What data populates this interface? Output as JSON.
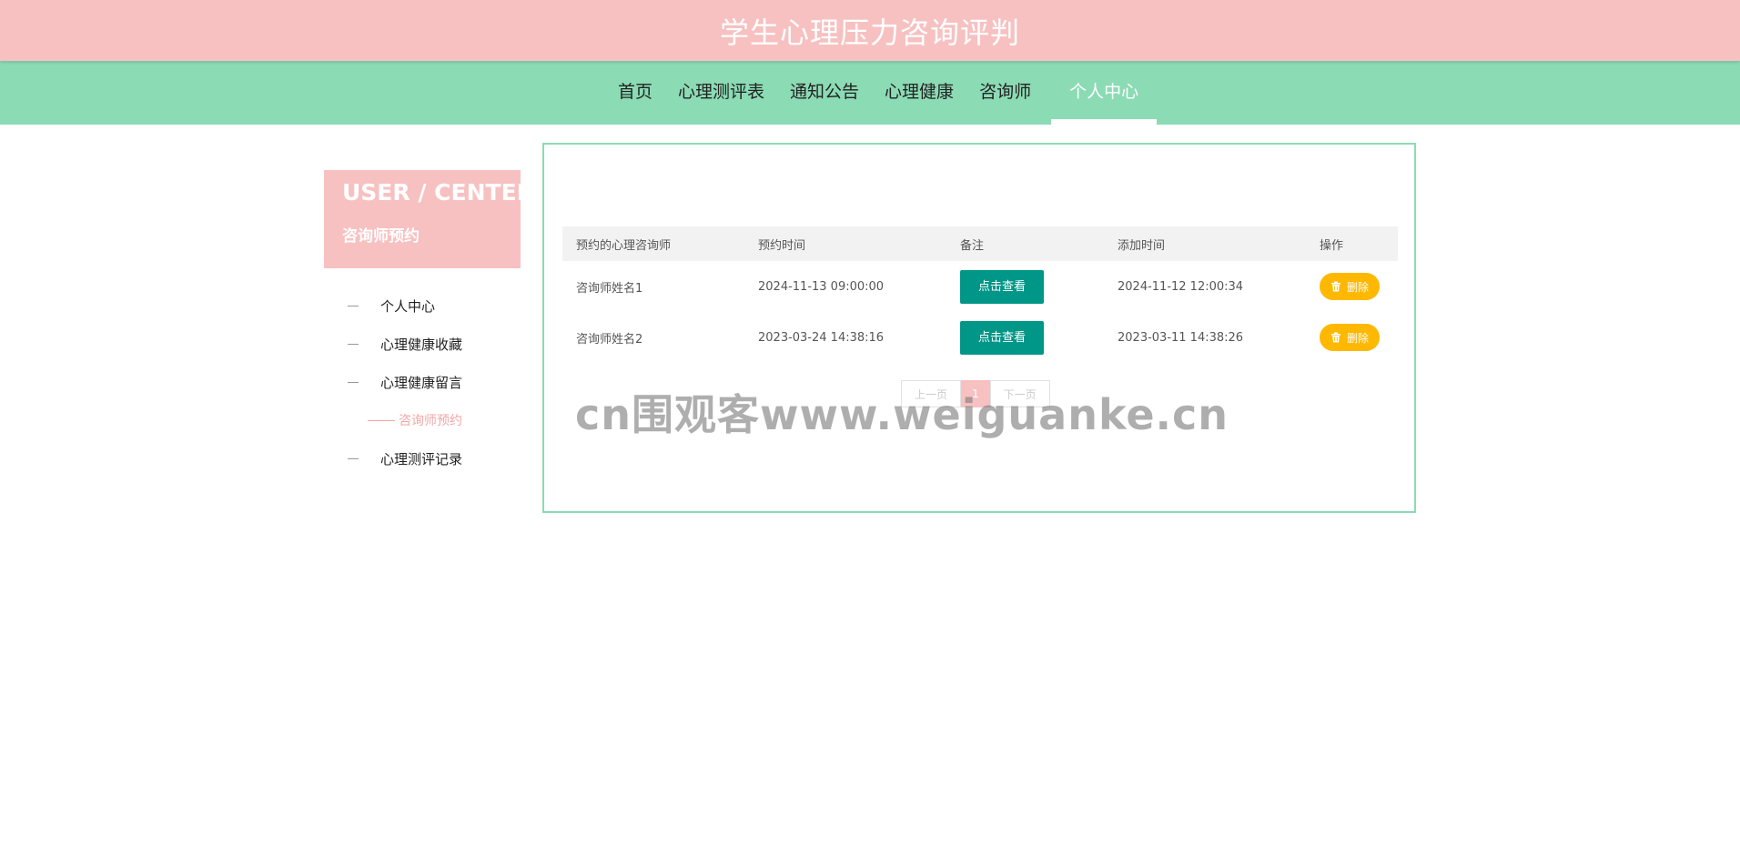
{
  "header": {
    "title": "学生心理压力咨询评判"
  },
  "nav": {
    "items": [
      {
        "label": "首页"
      },
      {
        "label": "心理测评表"
      },
      {
        "label": "通知公告"
      },
      {
        "label": "心理健康"
      },
      {
        "label": "咨询师"
      },
      {
        "label": "个人中心"
      }
    ],
    "active_index": 5
  },
  "sidebar": {
    "banner_en": "USER / CENTER",
    "banner_cn": "咨询师预约",
    "items": [
      {
        "label": "个人中心"
      },
      {
        "label": "心理健康收藏"
      },
      {
        "label": "心理健康留言"
      },
      {
        "label": "咨询师预约"
      },
      {
        "label": "心理测评记录"
      }
    ],
    "active_index": 3
  },
  "table": {
    "columns": [
      "预约的心理咨询师",
      "预约时间",
      "备注",
      "添加时间",
      "操作"
    ],
    "rows": [
      {
        "counselor": "咨询师姓名1",
        "appointment_time": "2024-11-13 09:00:00",
        "remark_button": "点击查看",
        "added_time": "2024-11-12 12:00:34",
        "delete_button": "删除"
      },
      {
        "counselor": "咨询师姓名2",
        "appointment_time": "2023-03-24 14:38:16",
        "remark_button": "点击查看",
        "added_time": "2023-03-11 14:38:26",
        "delete_button": "删除"
      }
    ]
  },
  "pager": {
    "prev": "上一页",
    "current": "1",
    "next": "下一页"
  },
  "watermark": "cn围观客www.weiguanke.cn",
  "icons": {
    "delete": "trash-icon"
  },
  "colors": {
    "header_bg": "#f7c1c1",
    "nav_bg": "#8bdbb5",
    "view_button": "#009688",
    "delete_button": "#ffb800"
  }
}
